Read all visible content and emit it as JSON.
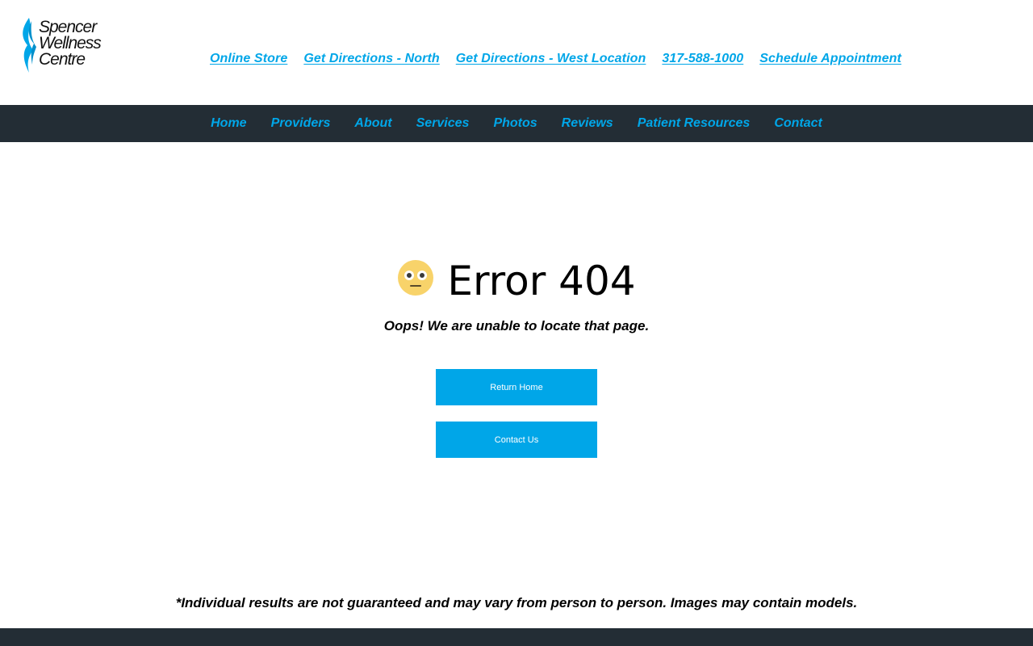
{
  "brand": {
    "logo_lines": [
      "Spencer",
      "Wellness",
      "Centre"
    ],
    "accent_color": "#00a6e8",
    "nav_bg_color": "#232d35"
  },
  "top_links": [
    {
      "label": "Online Store"
    },
    {
      "label": "Get Directions - North"
    },
    {
      "label": "Get Directions - West Location"
    },
    {
      "label": "317-588-1000"
    },
    {
      "label": "Schedule Appointment"
    }
  ],
  "nav": {
    "items": [
      {
        "label": "Home"
      },
      {
        "label": "Providers"
      },
      {
        "label": "About"
      },
      {
        "label": "Services"
      },
      {
        "label": "Photos"
      },
      {
        "label": "Reviews"
      },
      {
        "label": "Patient Resources"
      },
      {
        "label": "Contact"
      }
    ]
  },
  "error": {
    "emoji_icon": "flushed-face-icon",
    "title": "Error 404",
    "message": "Oops! We are unable to locate that page.",
    "return_home_label": "Return Home",
    "contact_us_label": "Contact Us"
  },
  "footer": {
    "disclaimer": "*Individual results are not guaranteed and may vary from person to person. Images may contain models."
  }
}
